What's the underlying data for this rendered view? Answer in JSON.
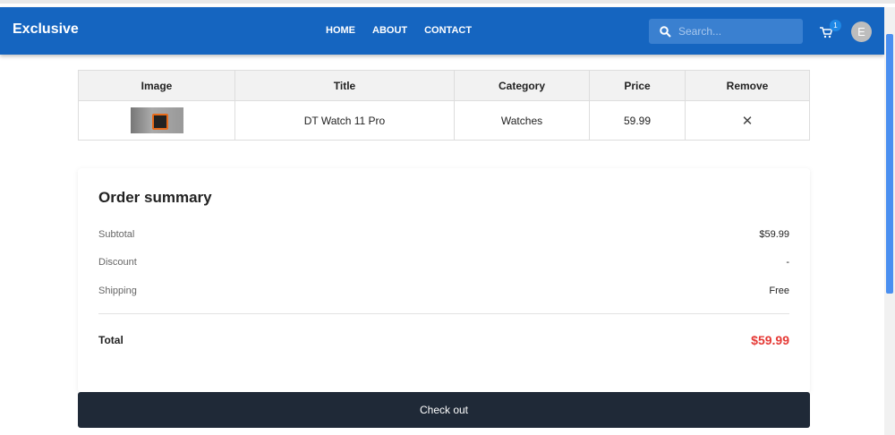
{
  "header": {
    "logo": "Exclusive",
    "nav": [
      "HOME",
      "ABOUT",
      "CONTACT"
    ],
    "search_placeholder": "Search...",
    "cart_count": "1",
    "avatar_initial": "E"
  },
  "cart_table": {
    "headers": [
      "Image",
      "Title",
      "Category",
      "Price",
      "Remove"
    ],
    "rows": [
      {
        "title": "DT Watch 11 Pro",
        "category": "Watches",
        "price": "59.99",
        "remove": "✕"
      }
    ]
  },
  "summary": {
    "title": "Order summary",
    "subtotal_label": "Subtotal",
    "subtotal": "$59.99",
    "discount_label": "Discount",
    "discount": "-",
    "shipping_label": "Shipping",
    "shipping": "Free",
    "total_label": "Total",
    "total": "$59.99"
  },
  "checkout_label": "Check out"
}
